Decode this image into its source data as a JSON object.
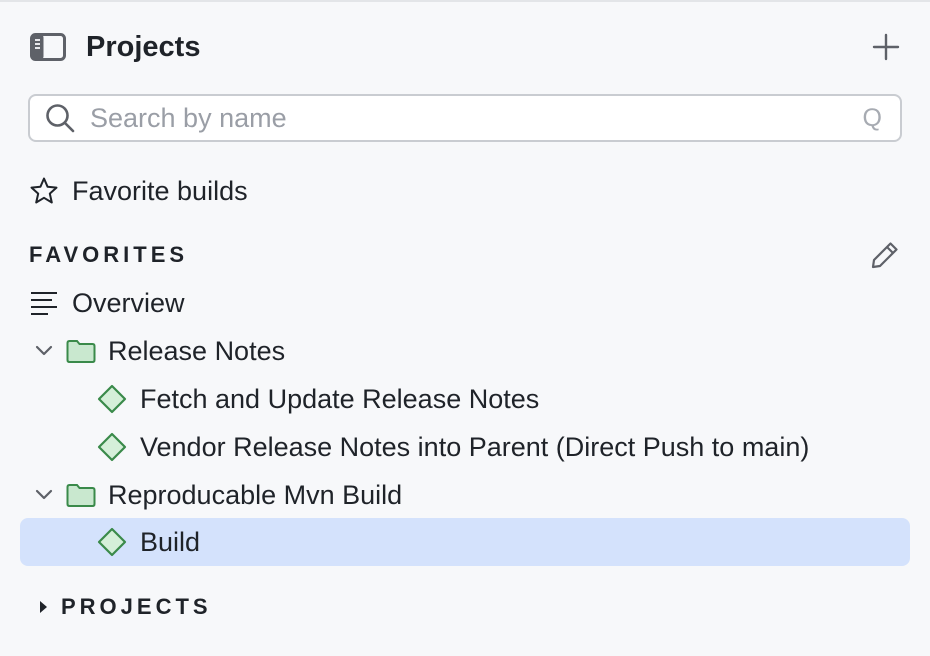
{
  "header": {
    "title": "Projects",
    "panel_icon": "sidebar-panel-icon",
    "add_icon": "plus-icon"
  },
  "search": {
    "placeholder": "Search by name",
    "value": "",
    "hotkey": "Q"
  },
  "favorite_builds": {
    "label": "Favorite builds",
    "icon": "star-icon"
  },
  "favorites_section": {
    "title": "FAVORITES",
    "edit_icon": "pencil-icon",
    "overview": {
      "label": "Overview",
      "icon": "list-lines-icon"
    },
    "groups": [
      {
        "label": "Release Notes",
        "expanded": true,
        "items": [
          {
            "label": "Fetch and Update Release Notes"
          },
          {
            "label": "Vendor Release Notes into Parent (Direct Push to main)"
          }
        ]
      },
      {
        "label": "Reproducable Mvn Build",
        "expanded": true,
        "items": [
          {
            "label": "Build",
            "selected": true
          }
        ]
      }
    ]
  },
  "projects_section": {
    "title": "PROJECTS",
    "expanded": false
  },
  "colors": {
    "folder_fill": "#c9e8cf",
    "folder_stroke": "#3a8a4a",
    "diamond_fill": "#d5efd9",
    "diamond_stroke": "#3a8a4a",
    "selection": "#d4e2fc"
  }
}
